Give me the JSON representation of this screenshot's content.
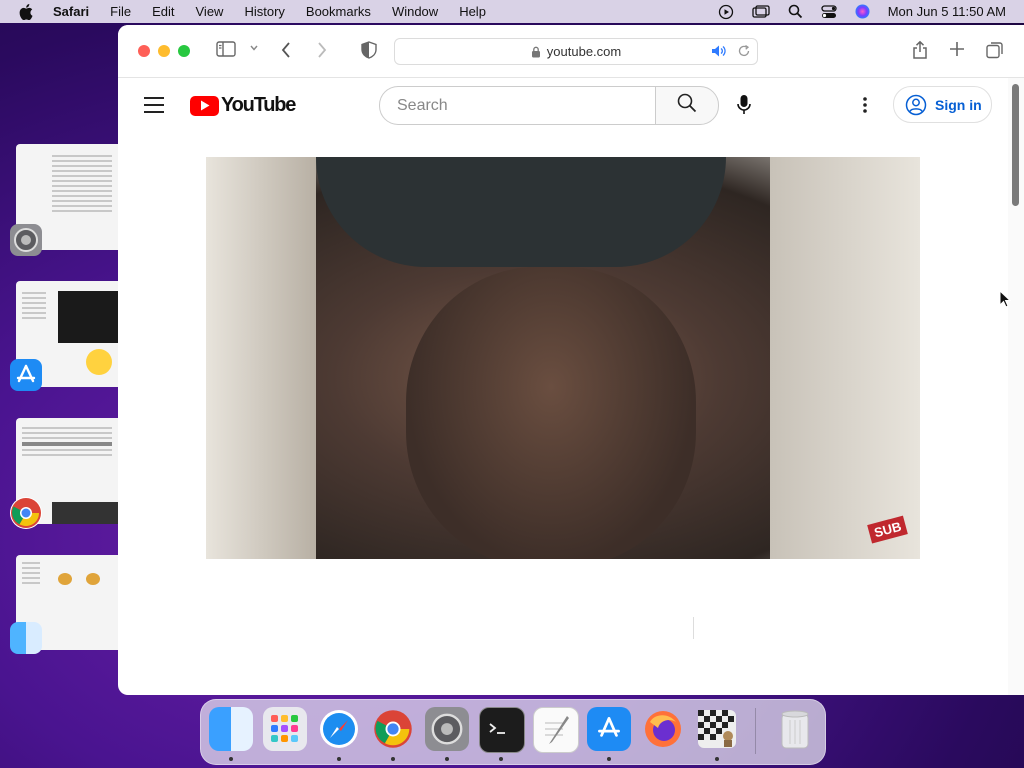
{
  "menubar": {
    "app_name": "Safari",
    "items": [
      "File",
      "Edit",
      "View",
      "History",
      "Bookmarks",
      "Window",
      "Help"
    ],
    "clock": "Mon Jun 5  11:50 AM"
  },
  "browser": {
    "url": "youtube.com"
  },
  "youtube": {
    "logo_text": "YouTube",
    "search_placeholder": "Search",
    "sign_in_label": "Sign in",
    "video_watermark": "SUB"
  },
  "colors": {
    "youtube_red": "#ff0000",
    "sign_in_blue": "#065fd4",
    "desktop_purple": "#4a1490"
  },
  "dock": {
    "apps": [
      "Finder",
      "Launchpad",
      "Safari",
      "Chrome",
      "System Preferences",
      "Terminal",
      "TextEdit",
      "App Store",
      "Firefox",
      "Chess",
      "Trash"
    ]
  }
}
